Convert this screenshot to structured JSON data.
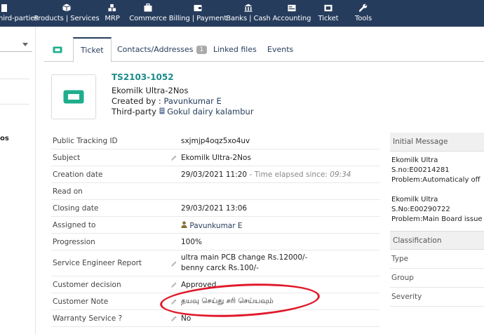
{
  "nav": [
    {
      "label": "Third-parties",
      "icon": "building-icon"
    },
    {
      "label": "Products | Services",
      "icon": "cube-icon"
    },
    {
      "label": "MRP",
      "icon": "cubes-icon"
    },
    {
      "label": "Commerce",
      "icon": "suitcase-icon"
    },
    {
      "label": "Billing | Payment",
      "icon": "wallet-icon"
    },
    {
      "label": "Banks | Cash",
      "icon": "bank-icon"
    },
    {
      "label": "Accounting",
      "icon": "ledger-icon"
    },
    {
      "label": "Ticket",
      "icon": "ticket-icon"
    },
    {
      "label": "Tools",
      "icon": "wrench-icon"
    }
  ],
  "sidebar": {
    "partial_text": "os"
  },
  "tabs": [
    {
      "label": "Ticket",
      "active": true
    },
    {
      "label": "Contacts/Addresses",
      "badge": "1"
    },
    {
      "label": "Linked files"
    },
    {
      "label": "Events"
    }
  ],
  "header": {
    "ref": "TS2103-1052",
    "subject": "Ekomilk Ultra-2Nos",
    "created_prefix": "Created by :",
    "created_by": "Pavunkumar E",
    "thirdparty_prefix": "Third-party",
    "thirdparty": "Gokul dairy kalambur"
  },
  "fields": {
    "tracking": {
      "label": "Public Tracking ID",
      "value": "sxjmjp4oqz5xo4uv"
    },
    "subject": {
      "label": "Subject",
      "value": "Ekomilk Ultra-2Nos"
    },
    "creation": {
      "label": "Creation date",
      "value": "29/03/2021 11:20",
      "elapsed_prefix": " - Time elapsed since: ",
      "elapsed": "09:34"
    },
    "read": {
      "label": "Read on",
      "value": ""
    },
    "closing": {
      "label": "Closing date",
      "value": "29/03/2021 13:06"
    },
    "assigned": {
      "label": "Assigned to",
      "value": "Pavunkumar E"
    },
    "progression": {
      "label": "Progression",
      "value": "100%"
    },
    "report": {
      "label": "Service Engineer Report",
      "line1": "ultra main PCB change Rs.12000/-",
      "line2": "benny carck Rs.100/-"
    },
    "decision": {
      "label": "Customer decision",
      "value": "Approved"
    },
    "note": {
      "label": "Customer Note",
      "value": "தயவு செய்து சரி செய்யவும்"
    },
    "warranty": {
      "label": "Warranty Service ?",
      "value": "No"
    }
  },
  "right": {
    "initial_title": "Initial Message",
    "message_lines": [
      "Ekomilk Ultra",
      "S.no:E00214281",
      "Problem:Automaticaly off",
      "",
      "Ekomilk Ultra",
      "S.No:E00290722",
      "Problem:Main Board issue"
    ],
    "classification_title": "Classification",
    "class_rows": [
      "Type",
      "Group",
      "Severity"
    ]
  },
  "colors": {
    "nav_bg": "#263c5c",
    "ref_teal": "#1b8b8b",
    "green": "#2fbf3a",
    "annotation_red": "#e0192a"
  }
}
